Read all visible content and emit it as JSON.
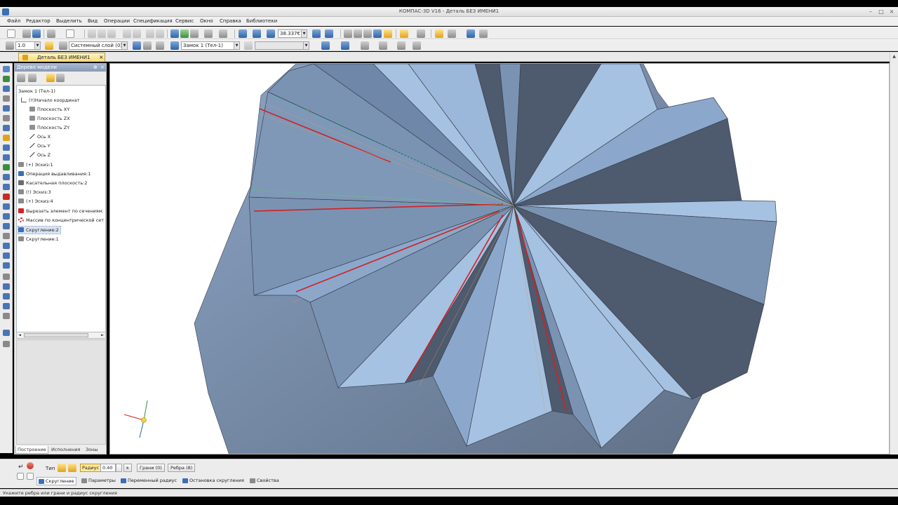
{
  "window": {
    "title": "КОМПАС-3D V16  - Деталь БЕЗ ИМЕНИ1"
  },
  "menu": [
    "Файл",
    "Редактор",
    "Выделить",
    "Вид",
    "Операции",
    "Спецификация",
    "Сервис",
    "Окно",
    "Справка",
    "Библиотеки"
  ],
  "toolbar": {
    "zoom_value": "38.337€",
    "line_scale": "1.0",
    "layer": "Системный слой (0)",
    "object": "Замок 1 (Тел-1)",
    "empty_combo": ""
  },
  "document_tab": {
    "label": "Деталь БЕЗ ИМЕНИ1",
    "close": "×"
  },
  "tree_panel": {
    "title": "Дерево модели",
    "pin": "⊕",
    "close": "×",
    "items": [
      {
        "label": "Замок 1 (Тел-1)",
        "icon": "part-icon"
      },
      {
        "label": "(т)Начало координат",
        "icon": "origin-icon"
      },
      {
        "label": "Плоскость XY",
        "icon": "plane-icon"
      },
      {
        "label": "Плоскость ZX",
        "icon": "plane-icon"
      },
      {
        "label": "Плоскость ZY",
        "icon": "plane-icon"
      },
      {
        "label": "Ось X",
        "icon": "axis-icon"
      },
      {
        "label": "Ось Y",
        "icon": "axis-icon"
      },
      {
        "label": "Ось Z",
        "icon": "axis-icon"
      },
      {
        "label": "(+) Эскиз:1",
        "icon": "sketch-icon"
      },
      {
        "label": "Операция выдавливания:1",
        "icon": "extrude-icon"
      },
      {
        "label": "Касательная плоскость:2",
        "icon": "tangent-plane-icon"
      },
      {
        "label": "(!) Эскиз:3",
        "icon": "sketch-icon"
      },
      {
        "label": "(+) Эскиз:4",
        "icon": "sketch-icon"
      },
      {
        "label": "Вырезать элемент по сечениям:",
        "icon": "cut-loft-icon"
      },
      {
        "label": "Массив по концентрической сет",
        "icon": "circular-array-icon"
      },
      {
        "label": "Скругление:2",
        "icon": "fillet-icon"
      },
      {
        "label": "Скругление:1",
        "icon": "fillet-icon"
      }
    ],
    "tabs": [
      "Построение",
      "Исполнения",
      "Зоны"
    ]
  },
  "property_bar": {
    "type_label": "Тип",
    "radius_label": "Радиус",
    "radius_value": "0.40",
    "faces_button": "Грани (0)",
    "edges_button": "Ребра (8)",
    "tabs": [
      "Скругление",
      "Параметры",
      "Переменный радиус",
      "Остановка скругления",
      "Свойства"
    ]
  },
  "status": {
    "hint": "Укажите ребра или грани и радиус скругления"
  },
  "colors": {
    "face_light": "#a6c2e2",
    "face_mid": "#7b93b3",
    "face_dark": "#4e5a6d",
    "edge_red": "#d42020",
    "doc_tab": "#f5d978"
  }
}
